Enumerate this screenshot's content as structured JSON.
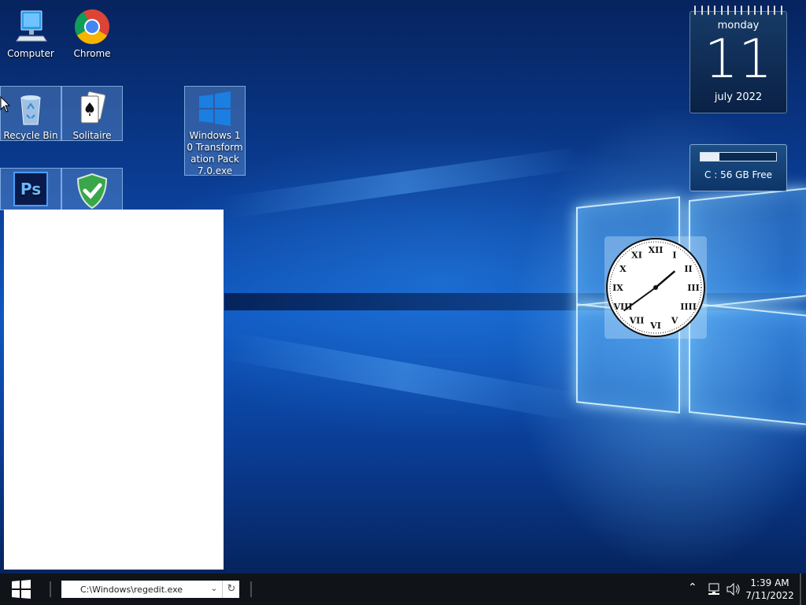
{
  "desktop": {
    "icons": [
      {
        "label": "Computer",
        "icon": "computer-icon"
      },
      {
        "label": "Chrome",
        "icon": "chrome-icon"
      },
      {
        "label": "Recycle Bin",
        "icon": "recycle-bin-icon"
      },
      {
        "label": "Solitaire",
        "icon": "solitaire-icon"
      },
      {
        "label": "Windows 10 Transformation Pack 7.0.exe",
        "icon": "installer-icon"
      },
      {
        "label": "",
        "icon": "photoshop-icon",
        "glyph": "Ps"
      },
      {
        "label": "",
        "icon": "security-shield-icon"
      }
    ]
  },
  "calendar_gadget": {
    "weekday": "monday",
    "day": "11",
    "month_year": "july 2022"
  },
  "disk_gadget": {
    "label": "C : 56 GB Free",
    "used_fraction": 0.25
  },
  "clock_gadget": {
    "time": "1:39",
    "numerals": [
      "XII",
      "I",
      "II",
      "III",
      "IIII",
      "V",
      "VI",
      "VII",
      "VIII",
      "IX",
      "X",
      "XI"
    ]
  },
  "taskbar": {
    "address_value": "C:\\Windows\\regedit.exe",
    "time": "1:39 AM",
    "date": "7/11/2022"
  },
  "colors": {
    "accent": "#0e57c0",
    "taskbar": "#101418"
  }
}
